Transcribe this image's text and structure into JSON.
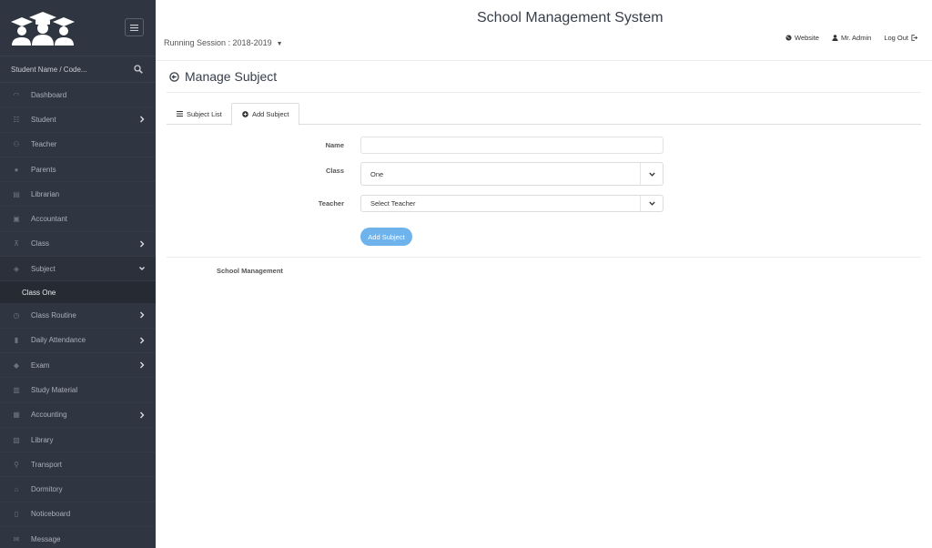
{
  "sidebar": {
    "search_placeholder": "Student Name / Code...",
    "items": [
      {
        "label": "Dashboard",
        "icon": "gauge-icon",
        "has_children": false
      },
      {
        "label": "Student",
        "icon": "users-icon",
        "has_children": true
      },
      {
        "label": "Teacher",
        "icon": "user-group-icon",
        "has_children": false
      },
      {
        "label": "Parents",
        "icon": "user-icon",
        "has_children": false
      },
      {
        "label": "Librarian",
        "icon": "book-icon",
        "has_children": false
      },
      {
        "label": "Accountant",
        "icon": "briefcase-icon",
        "has_children": false
      },
      {
        "label": "Class",
        "icon": "sitemap-icon",
        "has_children": true
      },
      {
        "label": "Subject",
        "icon": "bookmark-icon",
        "has_children": true,
        "open": true
      },
      {
        "label": "Class Routine",
        "icon": "clock-icon",
        "has_children": true
      },
      {
        "label": "Daily Attendance",
        "icon": "bar-chart-icon",
        "has_children": true
      },
      {
        "label": "Exam",
        "icon": "graduation-cap-icon",
        "has_children": true
      },
      {
        "label": "Study Material",
        "icon": "open-book-icon",
        "has_children": false
      },
      {
        "label": "Accounting",
        "icon": "suitcase-icon",
        "has_children": true
      },
      {
        "label": "Library",
        "icon": "books-icon",
        "has_children": false
      },
      {
        "label": "Transport",
        "icon": "location-icon",
        "has_children": false
      },
      {
        "label": "Dormitory",
        "icon": "home-icon",
        "has_children": false
      },
      {
        "label": "Noticeboard",
        "icon": "clipboard-icon",
        "has_children": false
      },
      {
        "label": "Message",
        "icon": "envelope-icon",
        "has_children": false
      }
    ],
    "subject_submenu": [
      "Class One"
    ]
  },
  "header": {
    "title": "School Management System",
    "session": "Running Session : 2018-2019",
    "links": {
      "website": "Website",
      "admin": "Mr. Admin",
      "logout": "Log Out"
    }
  },
  "page": {
    "title": "Manage Subject",
    "tabs": {
      "list": "Subject List",
      "add": "Add Subject"
    }
  },
  "form": {
    "name_label": "Name",
    "name_value": "",
    "class_label": "Class",
    "class_value": "One",
    "teacher_label": "Teacher",
    "teacher_value": "Select Teacher",
    "submit": "Add Subject"
  },
  "footer": {
    "text": "School Management"
  },
  "colors": {
    "sidebar_bg": "#303641",
    "button": "#6fb3ec",
    "title": "#373e4a"
  }
}
